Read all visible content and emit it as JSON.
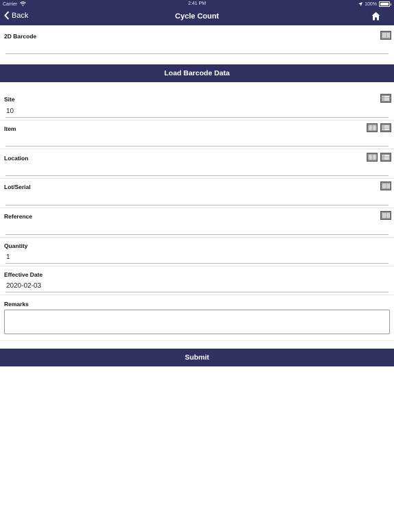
{
  "status_bar": {
    "carrier": "Carrier",
    "time": "2:41 PM",
    "battery": "100%"
  },
  "nav": {
    "back_label": "Back",
    "title": "Cycle Count"
  },
  "form": {
    "barcode_label": "2D Barcode",
    "barcode_value": "",
    "load_button": "Load Barcode Data",
    "site_label": "Site",
    "site_value": "10",
    "item_label": "Item",
    "item_value": "",
    "location_label": "Location",
    "location_value": "",
    "lot_label": "Lot/Serial",
    "lot_value": "",
    "reference_label": "Reference",
    "reference_value": "",
    "quantity_label": "Quantity",
    "quantity_value": "1",
    "date_label": "Effective Date",
    "date_value": "2020-02-03",
    "remarks_label": "Remarks",
    "remarks_value": "",
    "submit_button": "Submit"
  },
  "icons": {
    "barcode": "barcode-scan-icon",
    "list": "list-lookup-icon",
    "home": "home-icon",
    "back": "chevron-left-icon",
    "wifi": "wifi-icon",
    "location_arrow": "location-arrow-icon",
    "battery": "battery-icon"
  },
  "colors": {
    "nav_bg": "#2f3160",
    "button_bg": "#2f3160",
    "icon_bg": "#8a8a8a"
  }
}
